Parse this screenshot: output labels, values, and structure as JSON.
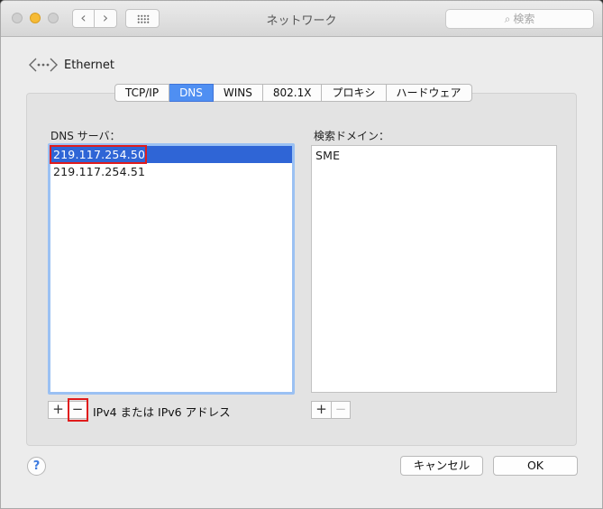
{
  "window": {
    "title": "ネットワーク"
  },
  "toolbar": {
    "back_icon": "chevron-left",
    "forward_icon": "chevron-right",
    "grid_icon": "show-all-grid",
    "search_placeholder": "検索",
    "search_icon": "magnifier"
  },
  "header": {
    "service_name": "Ethernet",
    "icon": "ethernet-arrows"
  },
  "tabs": [
    {
      "label": "TCP/IP",
      "active": false
    },
    {
      "label": "DNS",
      "active": true
    },
    {
      "label": "WINS",
      "active": false
    },
    {
      "label": "802.1X",
      "active": false
    },
    {
      "label": "プロキシ",
      "active": false
    },
    {
      "label": "ハードウェア",
      "active": false
    }
  ],
  "dns": {
    "label": "DNS サーバ：",
    "servers": [
      "219.117.254.50",
      "219.117.254.51"
    ],
    "selected_index": 0,
    "add_label": "+",
    "remove_label": "−",
    "hint": "IPv4 または IPv6 アドレス"
  },
  "domains": {
    "label": "検索ドメイン：",
    "items": [
      "SME"
    ],
    "add_label": "+",
    "remove_label": "−"
  },
  "footer": {
    "help_label": "?",
    "cancel_label": "キャンセル",
    "ok_label": "OK"
  },
  "colors": {
    "selection": "#2f65d6",
    "active_tab": "#4f8ff2",
    "highlight_box": "#e01c1c",
    "minimize_light": "#f6bb36"
  }
}
